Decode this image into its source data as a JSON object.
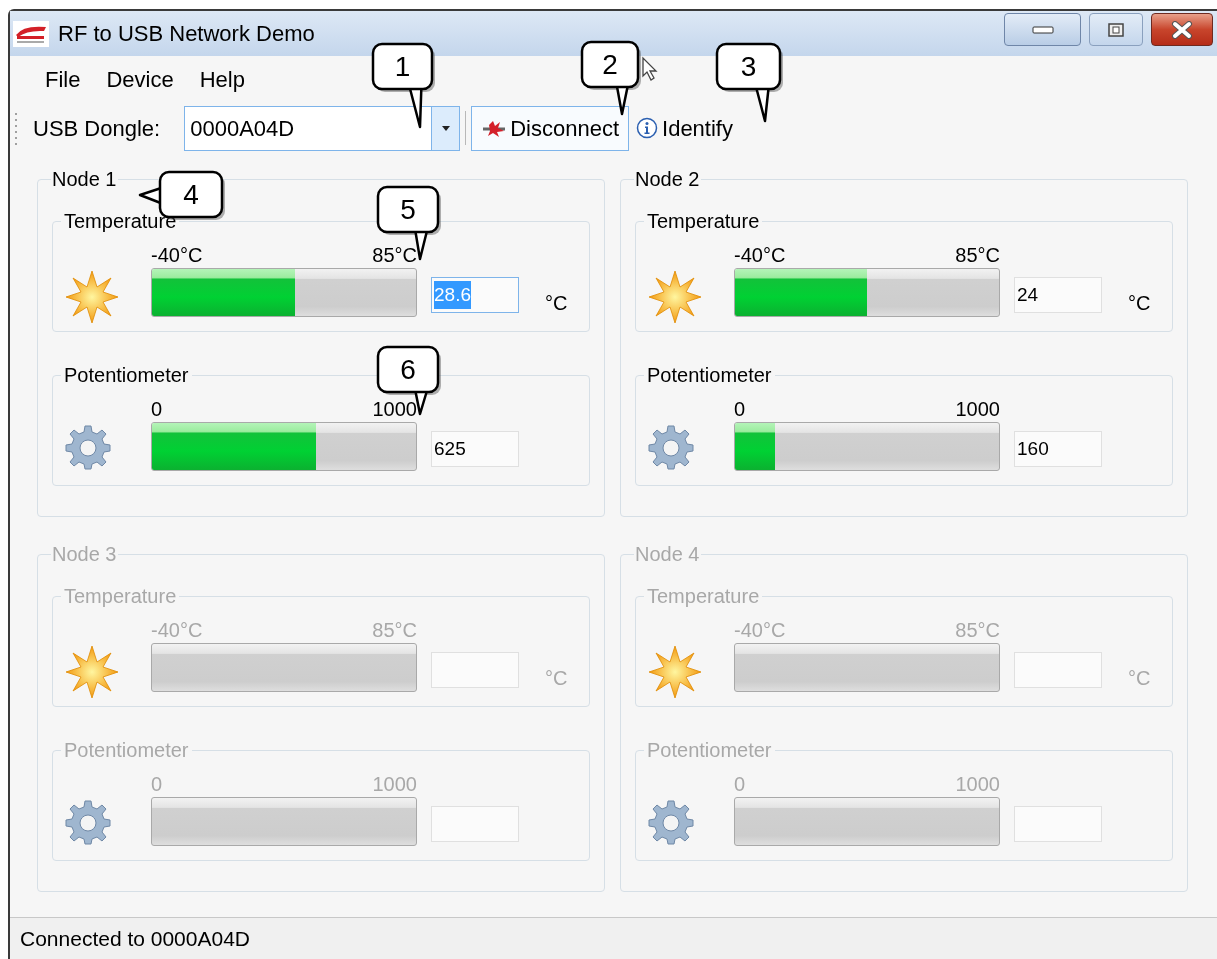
{
  "window": {
    "title": "RF to USB Network Demo"
  },
  "menu": [
    "File",
    "Device",
    "Help"
  ],
  "toolbar": {
    "dongle_label": "USB Dongle:",
    "dongle_value": "0000A04D",
    "disconnect": "Disconnect",
    "identify": "Identify"
  },
  "nodes": [
    {
      "title": "Node 1",
      "enabled": true,
      "sensors": [
        {
          "kind": "temperature",
          "title": "Temperature",
          "min": "-40°C",
          "max": "85°C",
          "level": 0.54,
          "value": "28.6",
          "focused": true,
          "unit": "°C"
        },
        {
          "kind": "potentiometer",
          "title": "Potentiometer",
          "min": "0",
          "max": "1000",
          "level": 0.62,
          "value": "625",
          "focused": false
        }
      ]
    },
    {
      "title": "Node 2",
      "enabled": true,
      "sensors": [
        {
          "kind": "temperature",
          "title": "Temperature",
          "min": "-40°C",
          "max": "85°C",
          "level": 0.5,
          "value": "24",
          "focused": false,
          "unit": "°C"
        },
        {
          "kind": "potentiometer",
          "title": "Potentiometer",
          "min": "0",
          "max": "1000",
          "level": 0.15,
          "value": "160",
          "focused": false
        }
      ]
    },
    {
      "title": "Node 3",
      "enabled": false,
      "sensors": [
        {
          "kind": "temperature",
          "title": "Temperature",
          "min": "-40°C",
          "max": "85°C",
          "unit": "°C"
        },
        {
          "kind": "potentiometer",
          "title": "Potentiometer",
          "min": "0",
          "max": "1000"
        }
      ]
    },
    {
      "title": "Node 4",
      "enabled": false,
      "sensors": [
        {
          "kind": "temperature",
          "title": "Temperature",
          "min": "-40°C",
          "max": "85°C",
          "unit": "°C"
        },
        {
          "kind": "potentiometer",
          "title": "Potentiometer",
          "min": "0",
          "max": "1000"
        }
      ]
    }
  ],
  "callouts": [
    {
      "label": "1"
    },
    {
      "label": "2"
    },
    {
      "label": "3"
    },
    {
      "label": "4"
    },
    {
      "label": "5"
    },
    {
      "label": "6"
    }
  ],
  "status_bar": "Connected to 0000A04D"
}
